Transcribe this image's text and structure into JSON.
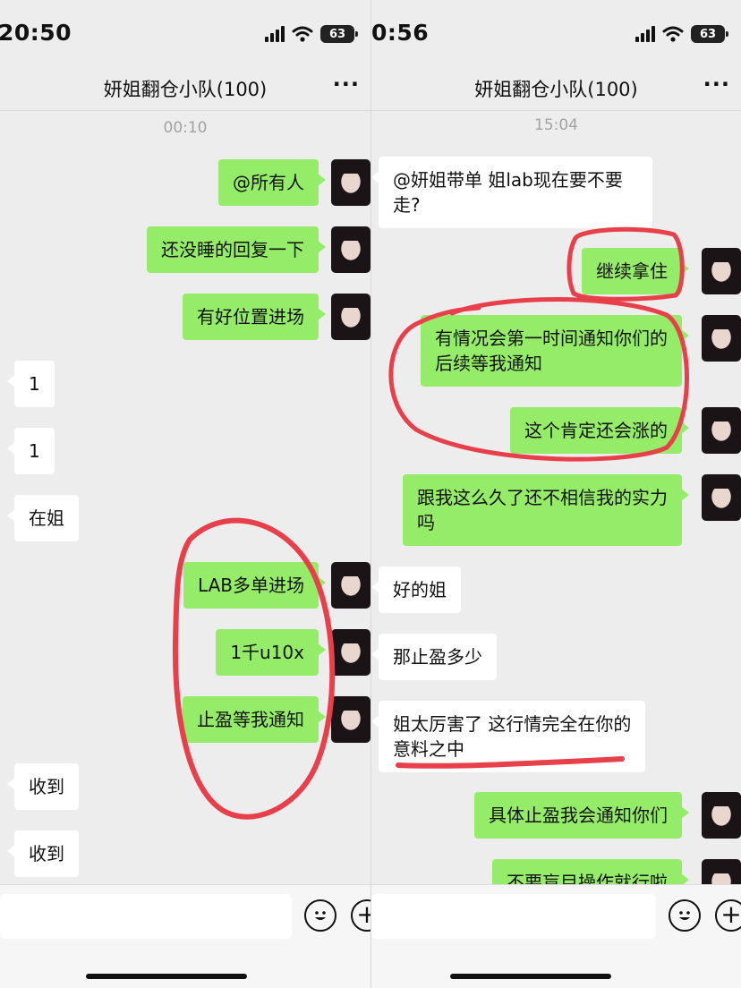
{
  "left": {
    "status_time": "20:50",
    "battery": "63",
    "title": "妍姐翻仓小队(100)",
    "more": "···",
    "timestamp": "00:10",
    "messages": [
      {
        "side": "out",
        "text": "@所有人"
      },
      {
        "side": "out",
        "text": "还没睡的回复一下"
      },
      {
        "side": "out",
        "text": "有好位置进场"
      },
      {
        "side": "in",
        "text": "1"
      },
      {
        "side": "in",
        "text": "1"
      },
      {
        "side": "in",
        "text": "在姐"
      },
      {
        "side": "out",
        "text": "LAB多单进场"
      },
      {
        "side": "out",
        "text": "1千u10x"
      },
      {
        "side": "out",
        "text": "止盈等我通知"
      },
      {
        "side": "in",
        "text": "收到"
      },
      {
        "side": "in",
        "text": "收到"
      }
    ],
    "emoji_icon": "smiley-face-icon",
    "plus_icon": "plus-icon",
    "plus_glyph": "+",
    "annotation_color": "#e8404a"
  },
  "right": {
    "status_time": "0:56",
    "battery": "63",
    "title": "妍姐翻仓小队(100)",
    "more": "···",
    "timestamp": "15:04",
    "messages": [
      {
        "side": "in",
        "text": "@妍姐带单 姐lab现在要不要\n走?"
      },
      {
        "side": "out",
        "text": "继续拿住"
      },
      {
        "side": "out",
        "text": "有情况会第一时间通知你们的\n后续等我通知"
      },
      {
        "side": "out",
        "text": "这个肯定还会涨的"
      },
      {
        "side": "out",
        "text": "跟我这么久了还不相信我的实力\n吗"
      },
      {
        "side": "in",
        "text": "好的姐"
      },
      {
        "side": "in",
        "text": "那止盈多少"
      },
      {
        "side": "in",
        "text": "姐太厉害了 这行情完全在你的\n意料之中"
      },
      {
        "side": "out",
        "text": "具体止盈我会通知你们"
      },
      {
        "side": "out",
        "text": "不要盲目操作就行啦"
      }
    ],
    "emoji_icon": "smiley-face-icon",
    "plus_icon": "plus-icon",
    "plus_glyph": "+",
    "annotation_color": "#e8404a"
  }
}
